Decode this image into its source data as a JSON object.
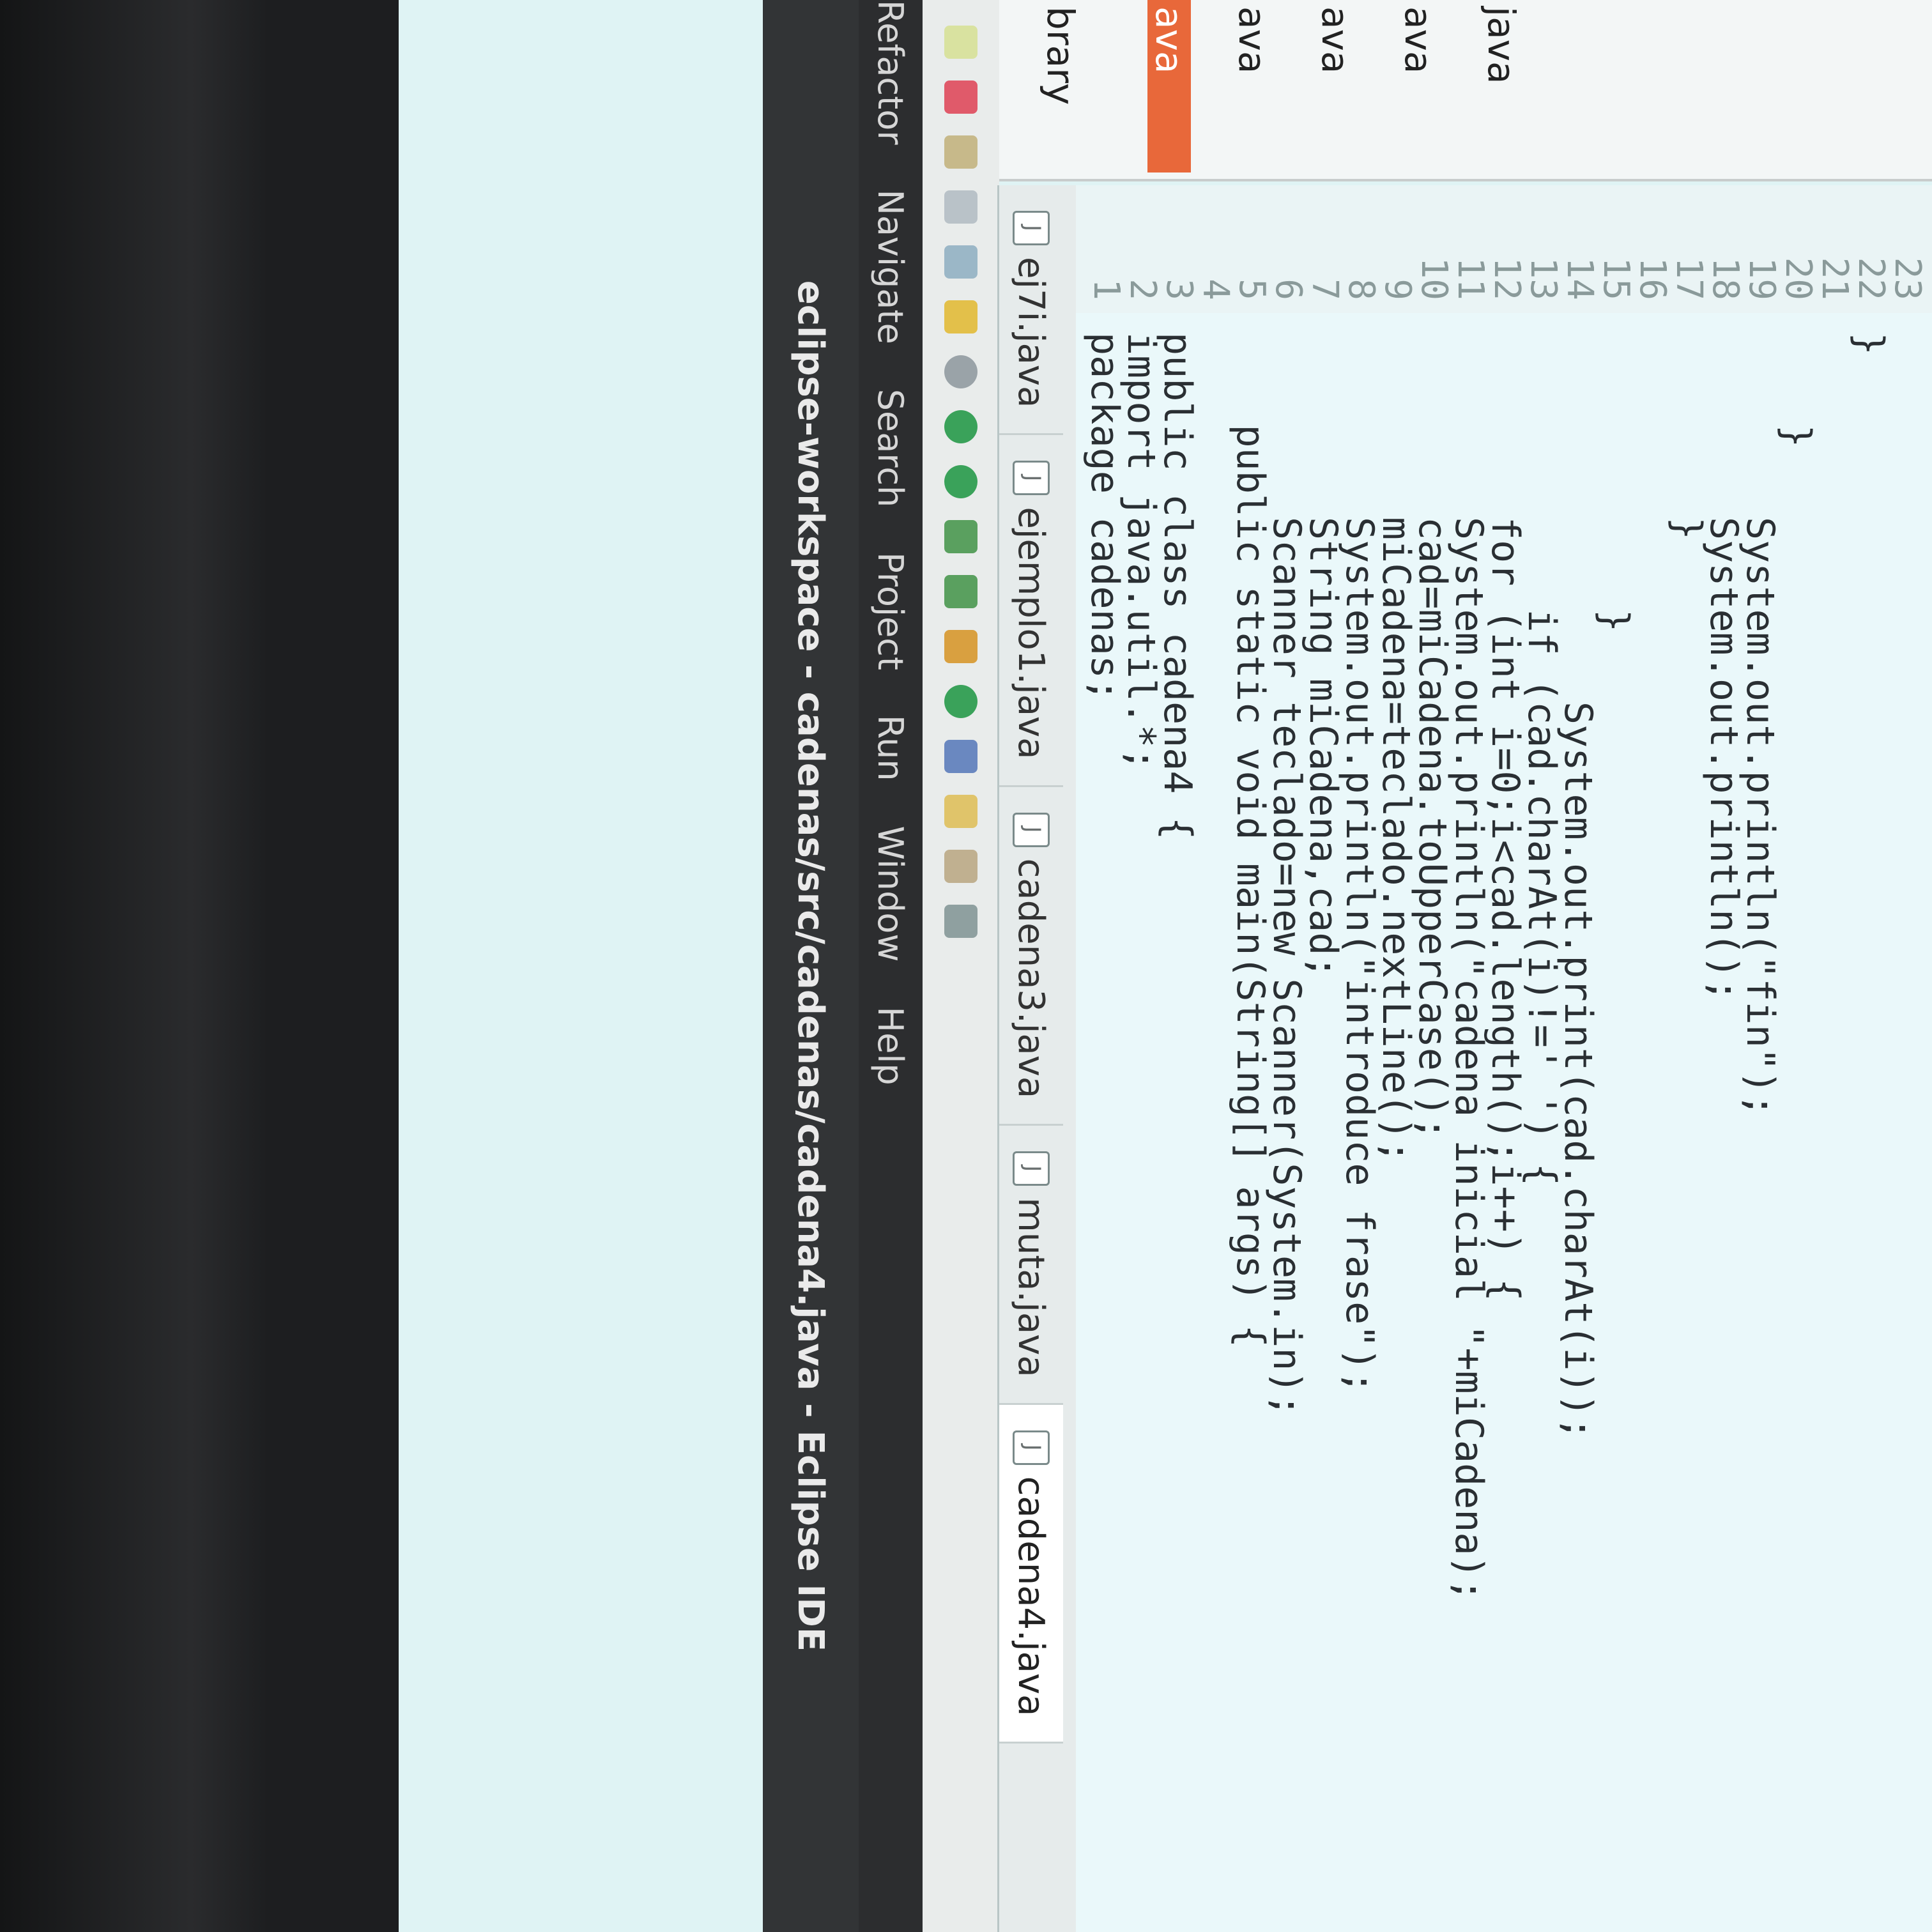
{
  "window": {
    "title": "eclipse-workspace - cadenas/src/cadenas/cadena4.java - Eclipse IDE"
  },
  "menu": {
    "items": [
      "Refactor",
      "Navigate",
      "Search",
      "Project",
      "Run",
      "Window",
      "Help"
    ]
  },
  "sidebar": {
    "items": [
      "brary",
      "ava",
      "ava",
      "ava",
      "ava",
      "java"
    ],
    "selected_index": 1
  },
  "tabs": [
    {
      "label": "ej7i.java",
      "active": false
    },
    {
      "label": "ejemplo1.java",
      "active": false
    },
    {
      "label": "cadena3.java",
      "active": false
    },
    {
      "label": "muta.java",
      "active": false
    },
    {
      "label": "cadena4.java",
      "active": true
    }
  ],
  "editor": {
    "lines": [
      {
        "n": "1",
        "text": "package cadenas;"
      },
      {
        "n": "2",
        "text": "import java.util.*;"
      },
      {
        "n": "3",
        "text": "public class cadena4 {"
      },
      {
        "n": "4",
        "text": ""
      },
      {
        "n": "5",
        "text": "    public static void main(String[] args) {"
      },
      {
        "n": "6",
        "text": "        Scanner teclado=new Scanner(System.in);"
      },
      {
        "n": "7",
        "text": "        String miCadena,cad;"
      },
      {
        "n": "8",
        "text": "        System.out.println(\"introduce frase\");"
      },
      {
        "n": "9",
        "text": "        miCadena=teclado.nextLine();"
      },
      {
        "n": "10",
        "text": "        cad=miCadena.toUpperCase();"
      },
      {
        "n": "11",
        "text": "        System.out.println(\"cadena inicial \"+miCadena);"
      },
      {
        "n": "12",
        "text": "        for (int i=0;i<cad.length();i++) {"
      },
      {
        "n": "13",
        "text": "            if (cad.charAt(i)!=' ') {"
      },
      {
        "n": "14",
        "text": "                System.out.print(cad.charAt(i));"
      },
      {
        "n": "15",
        "text": "            }"
      },
      {
        "n": "16",
        "text": ""
      },
      {
        "n": "17",
        "text": "        }"
      },
      {
        "n": "18",
        "text": "        System.out.println();"
      },
      {
        "n": "19",
        "text": "        System.out.println(\"fin\");"
      },
      {
        "n": "20",
        "text": "    }"
      },
      {
        "n": "21",
        "text": ""
      },
      {
        "n": "22",
        "text": "}"
      },
      {
        "n": "23",
        "text": ""
      }
    ]
  },
  "colors": {
    "keyword": "#7f0055",
    "string": "#2a00ff",
    "field": "#0000c0",
    "editor_bg": "#eaf8fa",
    "titlebar_bg": "#323436"
  }
}
